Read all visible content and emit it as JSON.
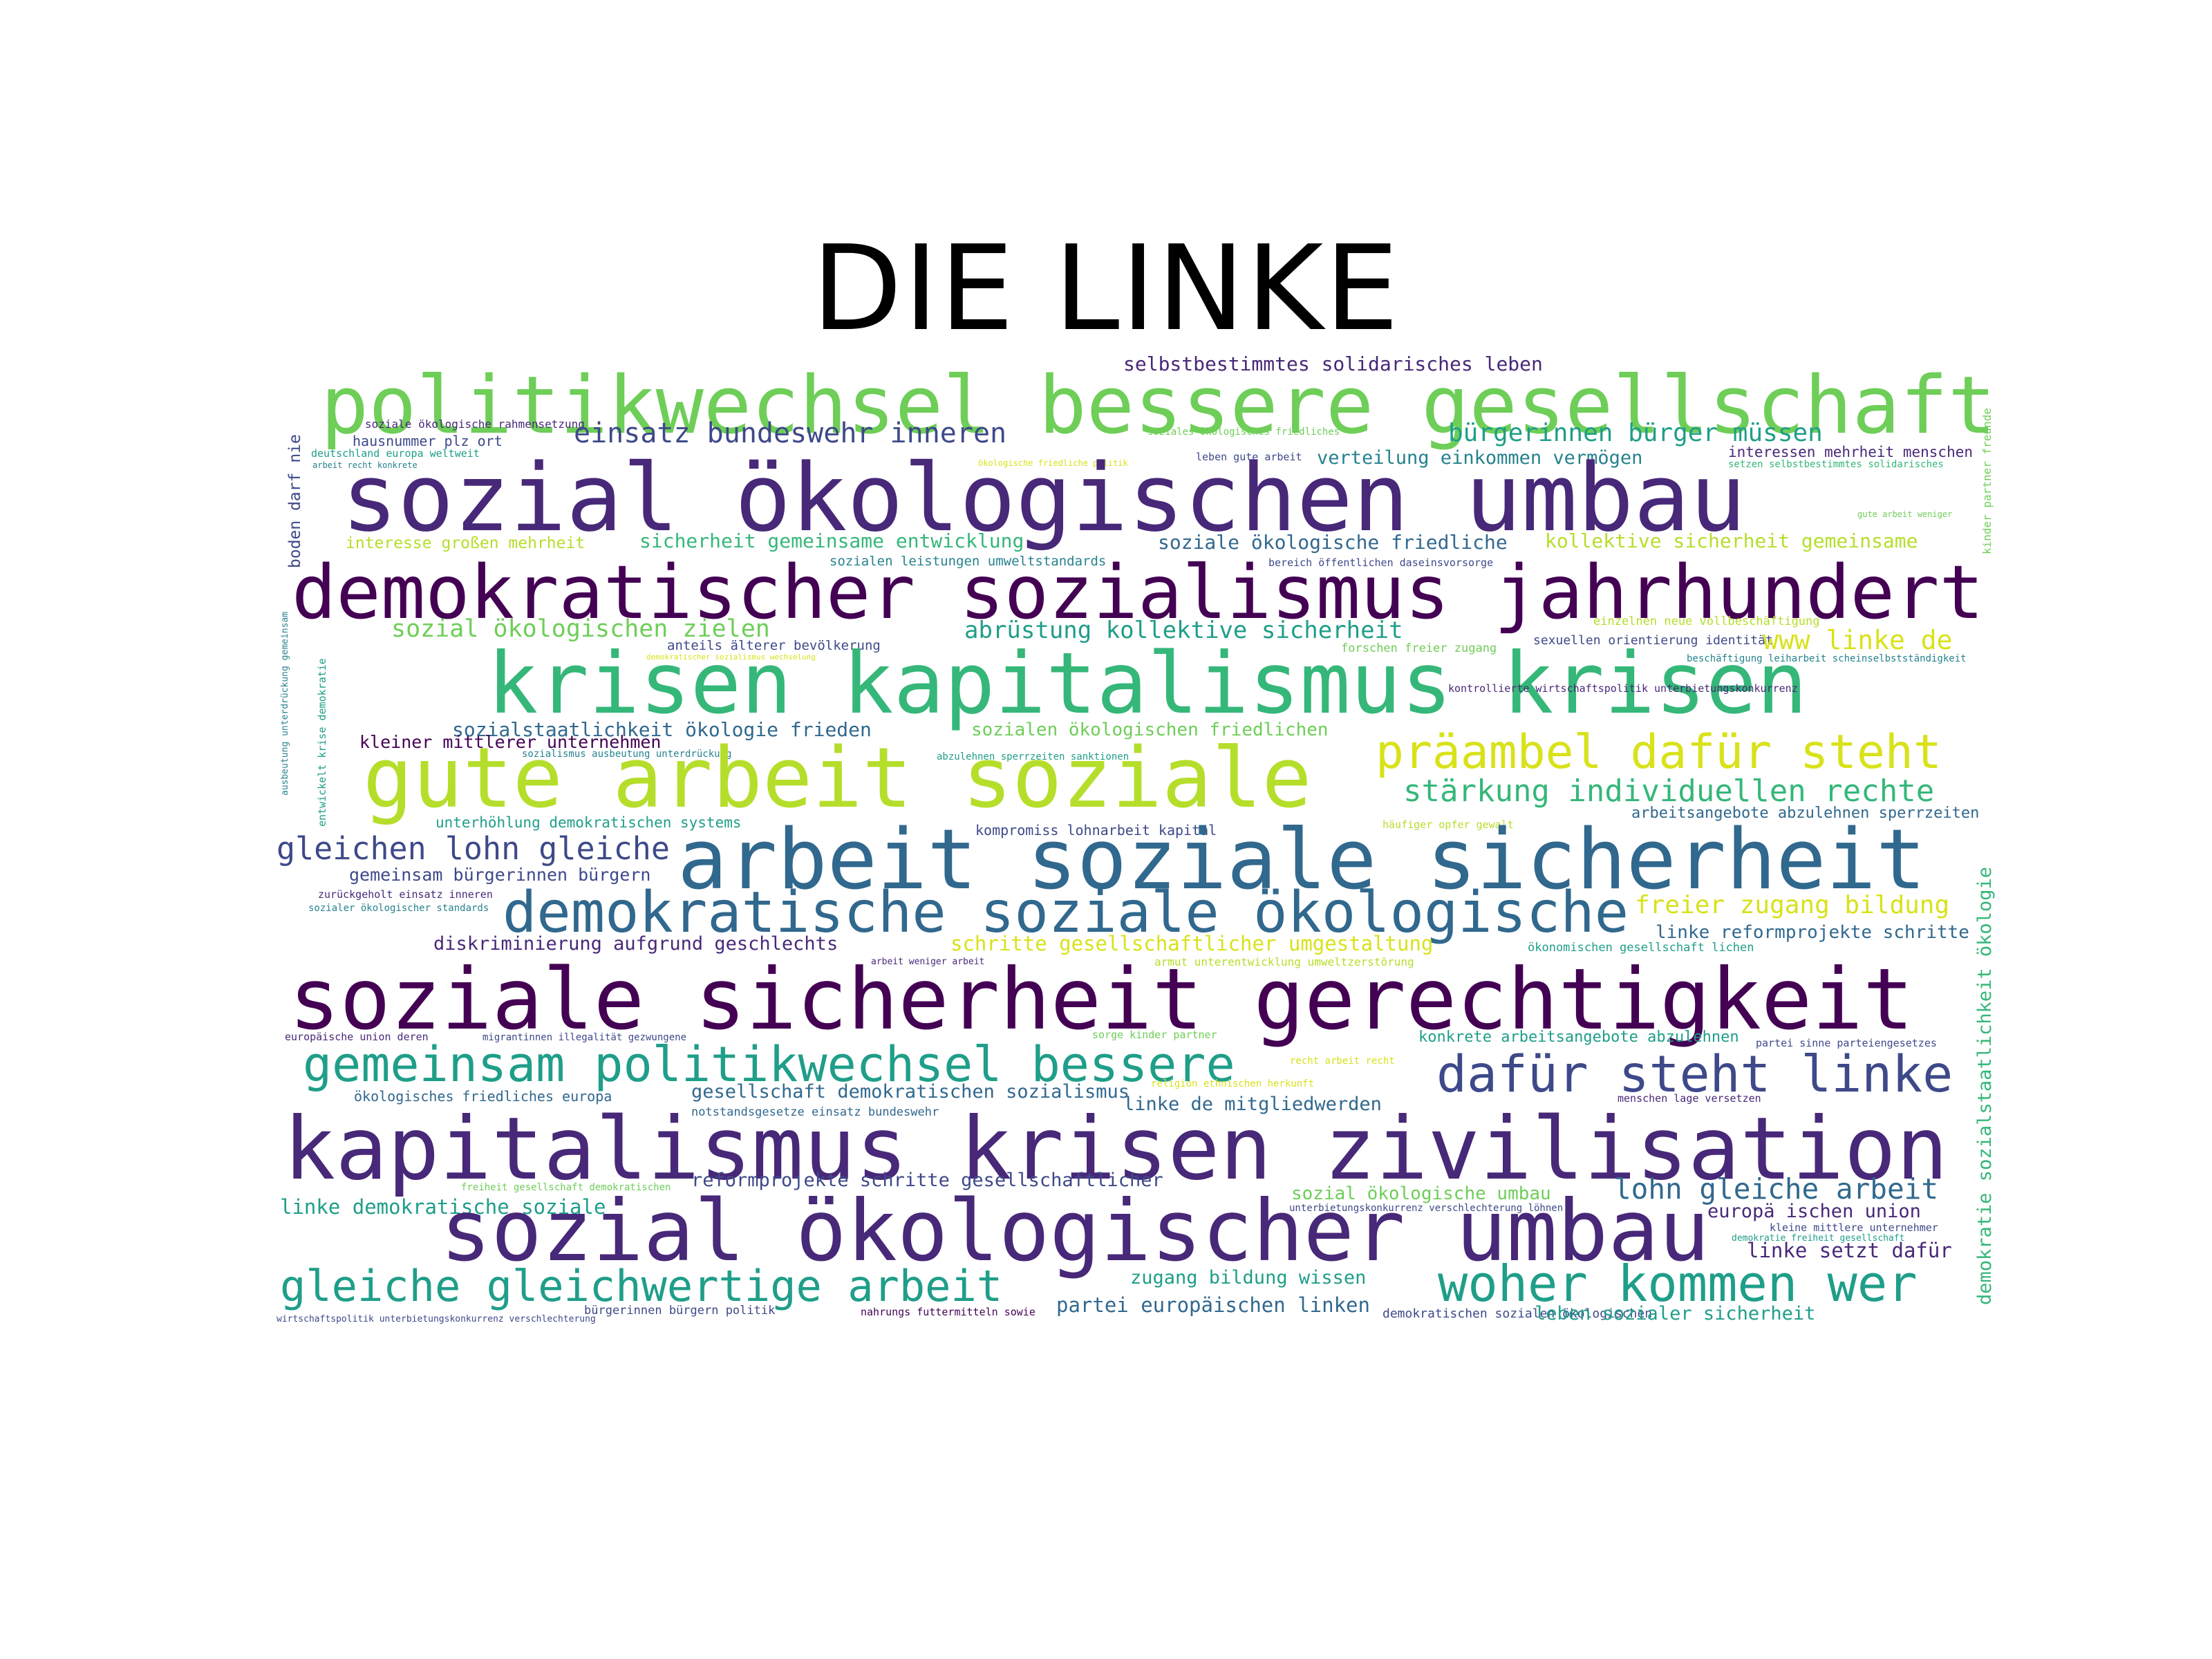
{
  "title": "DIE LINKE",
  "palette": {
    "c1": "#440154",
    "c2": "#482878",
    "c3": "#3e4989",
    "c4": "#31688e",
    "c5": "#26828e",
    "c6": "#1f9e89",
    "c7": "#35b779",
    "c8": "#6ece58",
    "c9": "#b5de2b",
    "c10": "#d8e219"
  },
  "words": [
    "selbstbestimmtes solidarisches leben",
    "politikwechsel bessere gesellschaft",
    "soziale ökologische rahmensetzung",
    "hausnummer plz ort",
    "deutschland europa weltweit",
    "arbeit recht konkrete",
    "einsatz bundeswehr inneren",
    "soziales ökologisches friedliches",
    "bürgerinnen bürger müssen",
    "leben gute arbeit",
    "verteilung einkommen vermögen",
    "ökologische friedliche politik",
    "interessen mehrheit menschen",
    "setzen selbstbestimmtes solidarisches",
    "sozial ökologischen umbau",
    "gute arbeit weniger",
    "interesse großen mehrheit",
    "sicherheit gemeinsame entwicklung",
    "soziale ökologische friedliche",
    "kollektive sicherheit gemeinsame",
    "sozialen leistungen umweltstandards",
    "bereich öffentlichen daseinsvorsorge",
    "demokratischer sozialismus jahrhundert",
    "sozial ökologischen zielen",
    "abrüstung kollektive sicherheit",
    "einzelnen neue vollbeschäftigung",
    "anteils älterer bevölkerung",
    "forschen freier zugang",
    "sexuellen orientierung identität",
    "www linke de",
    "demokratischer sozialismus wechselung",
    "beschäftigung leiharbeit scheinselbstständigkeit",
    "krisen kapitalismus krisen",
    "kontrollierte wirtschaftspolitik unterbietungskonkurrenz",
    "sozialstaatlichkeit ökologie frieden",
    "sozialen ökologischen friedlichen",
    "kleiner mittlerer unternehmen",
    "sozialismus ausbeutung unterdrückung",
    "abzulehnen sperrzeiten sanktionen",
    "präambel dafür steht",
    "gute arbeit soziale",
    "stärkung individuellen rechte",
    "unterhöhlung demokratischen systems",
    "arbeitsangebote abzulehnen sperrzeiten",
    "häufiger opfer gewalt",
    "kompromiss lohnarbeit kapital",
    "gleichen lohn gleiche",
    "arbeit soziale sicherheit",
    "gemeinsam bürgerinnen bürgern",
    "zurückgeholt einsatz inneren",
    "sozialer ökologischer standards",
    "demokratische soziale ökologische",
    "freier zugang bildung",
    "diskriminierung aufgrund geschlechts",
    "schritte gesellschaftlicher umgestaltung",
    "linke reformprojekte schritte",
    "ökonomischen gesellschaft lichen",
    "arbeit weniger arbeit",
    "armut unterentwicklung umweltzerstörung",
    "soziale sicherheit gerechtigkeit",
    "europäische union deren",
    "migrantinnen illegalität gezwungene",
    "sorge kinder partner",
    "konkrete arbeitsangebote abzulehnen",
    "partei sinne parteiengesetzes",
    "gemeinsam politikwechsel bessere",
    "recht arbeit recht",
    "dafür steht linke",
    "religion ethnischen herkunft",
    "gesellschaft demokratischen sozialismus",
    "ökologisches friedliches europa",
    "linke de mitgliedwerden",
    "menschen lage versetzen",
    "notstandsgesetze einsatz bundeswehr",
    "kapitalismus krisen zivilisation",
    "freiheit gesellschaft demokratischen",
    "reformprojekte schritte gesellschaftlicher",
    "sozial ökologische umbau",
    "lohn gleiche arbeit",
    "linke demokratische soziale",
    "unterbietungskonkurrenz verschlechterung löhnen",
    "europä ischen union",
    "kleine mittlere unternehmer",
    "demokratie freiheit gesellschaft",
    "sozial ökologischer umbau",
    "linke setzt dafür",
    "zugang bildung wissen",
    "gleiche gleichwertige arbeit",
    "woher kommen wer",
    "partei europäischen linken",
    "wirtschaftspolitik unterbietungskonkurrenz verschlechterung",
    "bürgerinnen bürgern politik",
    "nahrungs futtermitteln sowie",
    "demokratischen sozialen ökologischen",
    "leben sozialer sicherheit",
    "boden darf nie",
    "ausbeutung unterdrückung gemeinsam",
    "entwickelt krise demokratie",
    "kinder partner freunde",
    "demokratie sozialstaatlichkeit ökologie"
  ]
}
